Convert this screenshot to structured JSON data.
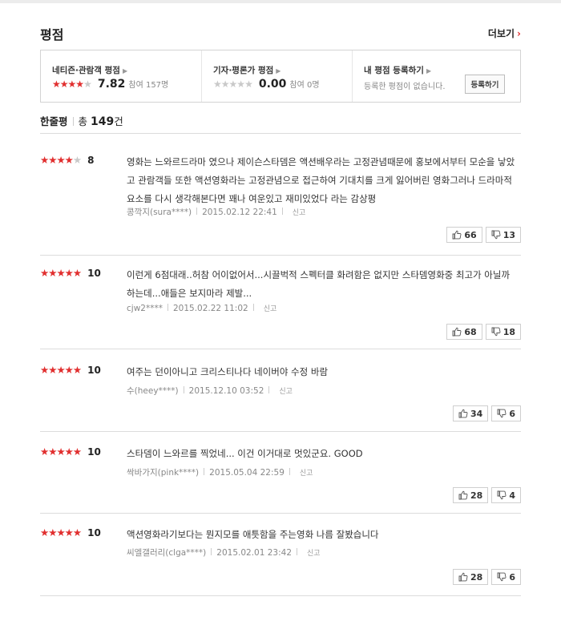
{
  "header": {
    "title": "평점",
    "more_label": "더보기",
    "more_arrow": "›"
  },
  "summary": {
    "netizen": {
      "label": "네티즌·관람객 평점",
      "stars_filled": 4,
      "score": "7.82",
      "participants": "참여 157명"
    },
    "critic": {
      "label": "기자·평론가 평점",
      "stars_filled": 0,
      "score": "0.00",
      "participants": "참여 0명"
    },
    "register": {
      "label": "내 평점 등록하기",
      "desc": "등록한 평점이 없습니다.",
      "button": "등록하기"
    }
  },
  "oneline": {
    "title": "한줄평",
    "total_prefix": "총",
    "total_count": "149",
    "total_suffix": "건"
  },
  "reviews": [
    {
      "stars_filled": 4,
      "score": "8",
      "text": "영화는 느와르드라마 였으나 제이슨스타뎀은 액션배우라는 고정관념때문에 홍보에서부터 모순을 낳았고 관람객들 또한 액션영화라는 고정관념으로 접근하여 기대치를 크게 잃어버린 영화그러나 드라마적 요소를 다시 생각해본다면 꽤나 여운있고 재미있었다 라는 감상평",
      "author": "콩깍지(sura****)",
      "date": "2015.02.12 22:41",
      "report": "신고",
      "up": "66",
      "down": "13"
    },
    {
      "stars_filled": 5,
      "score": "10",
      "text": "이런게 6점대래..허참 어이없어서...시끌벅적 스펙터클 화려함은 없지만 스타뎀영화중 최고가 아닐까 하는데...애들은 보지마라 제발...",
      "author": "cjw2****",
      "date": "2015.02.22 11:02",
      "report": "신고",
      "up": "68",
      "down": "18"
    },
    {
      "stars_filled": 5,
      "score": "10",
      "text": "여주는 던이아니고 크리스티나다 네이버야 수정 바람",
      "author": "수(heey****)",
      "date": "2015.12.10 03:52",
      "report": "신고",
      "up": "34",
      "down": "6"
    },
    {
      "stars_filled": 5,
      "score": "10",
      "text": "스타뎀이 느와르를 찍었네... 이건 이거대로 멋있군요. GOOD",
      "author": "싹바가지(pink****)",
      "date": "2015.05.04 22:59",
      "report": "신고",
      "up": "28",
      "down": "4"
    },
    {
      "stars_filled": 5,
      "score": "10",
      "text": "액션영화라기보다는 뭔지모를 애틋함을 주는영화 나름 잘봤습니다",
      "author": "씨엘갤러리(clga****)",
      "date": "2015.02.01 23:42",
      "report": "신고",
      "up": "28",
      "down": "6"
    }
  ],
  "colors": {
    "star_on": "#e12f2f",
    "star_off": "#c9c9c9",
    "accent": "#e12f2f"
  },
  "icons": {
    "upvote": "thumbs-up-icon",
    "downvote": "thumbs-down-icon"
  }
}
